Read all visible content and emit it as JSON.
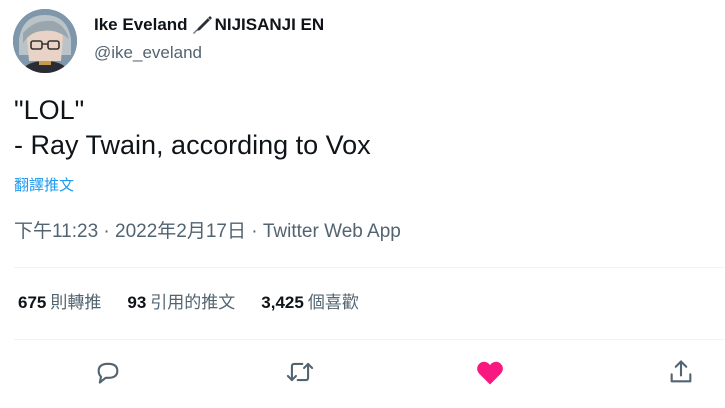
{
  "author": {
    "display_name": "Ike Eveland",
    "name_suffix": "NIJISANJI EN",
    "name_icon": "fountain-pen-icon",
    "handle": "@ike_eveland"
  },
  "tweet": {
    "lines": [
      "\"LOL\"",
      "- Ray Twain, according to Vox"
    ],
    "translate_label": "翻譯推文",
    "meta": "下午11:23 · 2022年2月17日 · Twitter Web App"
  },
  "stats": {
    "retweets": {
      "count": "675",
      "label": "則轉推"
    },
    "quotes": {
      "count": "93",
      "label": "引用的推文"
    },
    "likes": {
      "count": "3,425",
      "label": "個喜歡"
    }
  },
  "actions": {
    "reply_icon": "reply-icon",
    "retweet_icon": "retweet-icon",
    "like_icon": "heart-icon",
    "share_icon": "share-icon",
    "like_color": "#f91880",
    "icon_color": "#536471"
  }
}
